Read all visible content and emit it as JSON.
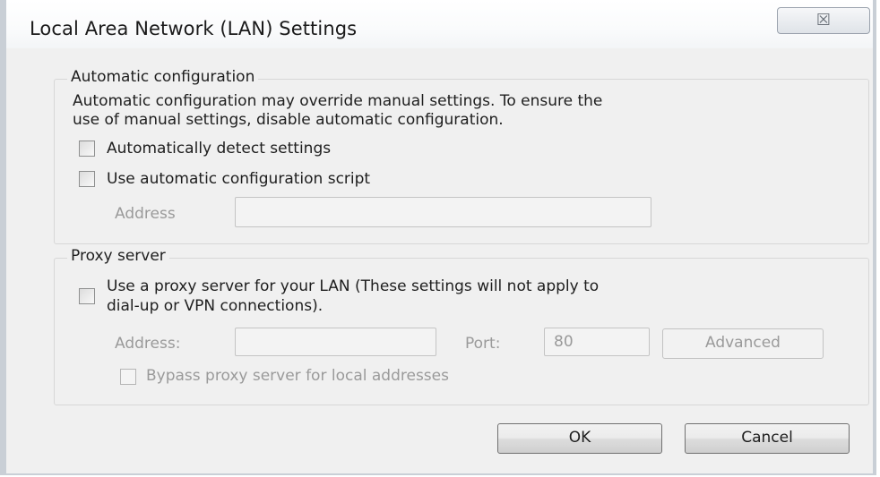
{
  "window": {
    "title": "Local Area Network (LAN) Settings",
    "close_glyph": "☒"
  },
  "auto_config": {
    "legend": "Automatic configuration",
    "description_line1": "Automatic configuration may override manual settings.  To ensure the",
    "description_line2": "use of manual settings, disable automatic configuration.",
    "detect_label": "Automatically detect settings",
    "detect_checked": false,
    "script_label": "Use automatic configuration script",
    "script_checked": false,
    "address_label": "Address",
    "address_value": ""
  },
  "proxy": {
    "legend": "Proxy server",
    "use_proxy_line1": "Use a proxy server for your LAN (These settings will not apply to",
    "use_proxy_line2": "dial-up or VPN connections).",
    "use_proxy_checked": false,
    "address_label": "Address:",
    "address_value": "",
    "port_label": "Port:",
    "port_value": "80",
    "advanced_label": "Advanced",
    "bypass_label": "Bypass proxy server for local addresses",
    "bypass_checked": false
  },
  "buttons": {
    "ok_label": "OK",
    "cancel_label": "Cancel"
  }
}
